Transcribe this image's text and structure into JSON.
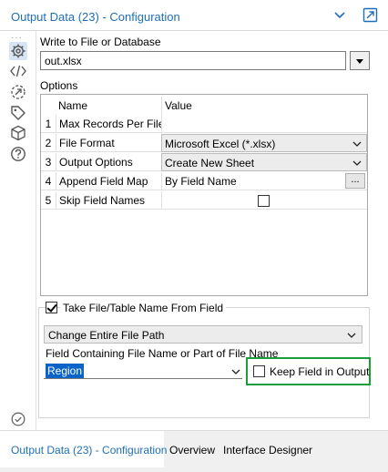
{
  "header": {
    "title": "Output Data (23) - Configuration",
    "collapse_icon": "chevron-down-icon",
    "popout_icon": "popout-icon",
    "accent": "#1f6fb6"
  },
  "rail": {
    "dots": "···",
    "icons": [
      "gear-icon",
      "code-icon",
      "annotation-icon",
      "tag-icon",
      "cube-icon",
      "help-icon",
      "check-circle-icon"
    ]
  },
  "write_to": {
    "label": "Write to File or Database",
    "value": "out.xlsx"
  },
  "options": {
    "label": "Options",
    "columns": {
      "num": "",
      "name": "Name",
      "value": "Value"
    },
    "rows": [
      {
        "num": "1",
        "name": "Max Records Per File",
        "value": ""
      },
      {
        "num": "2",
        "name": "File Format",
        "value": "Microsoft Excel (*.xlsx)"
      },
      {
        "num": "3",
        "name": "Output Options",
        "value": "Create New Sheet"
      },
      {
        "num": "4",
        "name": "Append Field Map",
        "value": "By Field Name",
        "button": "..."
      },
      {
        "num": "5",
        "name": "Skip Field Names",
        "checked": false
      }
    ]
  },
  "take_name": {
    "label": "Take File/Table Name From Field",
    "checked": true,
    "mode": "Change Entire File Path",
    "field_label": "Field Containing File Name or Part of File Name",
    "field_value": "Region",
    "keep_label": "Keep Field in Output",
    "keep_checked": false,
    "highlight_color": "#1b9e3a"
  },
  "footer": {
    "tabs": [
      {
        "label": "Output Data (23) - Configuration",
        "active": true
      },
      {
        "label": "Overview",
        "active": false
      },
      {
        "label": "Interface Designer",
        "active": false
      }
    ]
  }
}
